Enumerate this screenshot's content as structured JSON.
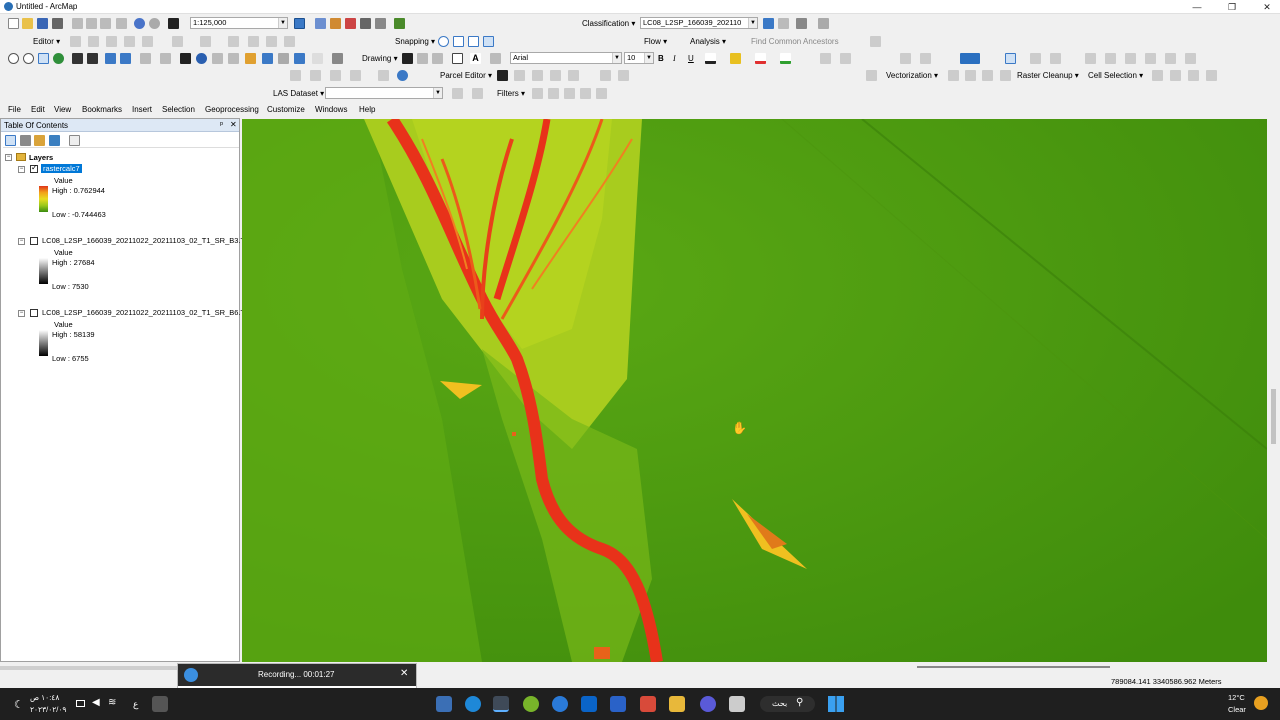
{
  "window": {
    "title": "Untitled - ArcMap",
    "minimize": "—",
    "maximize": "❐",
    "close": "✕"
  },
  "toolbar1": {
    "scale": "1:125,000",
    "classification_label": "Classification ▾",
    "layer_combo": "LC08_L2SP_166039_202110"
  },
  "toolbar2": {
    "editor": "Editor ▾",
    "snapping": "Snapping ▾",
    "drawing": "Drawing ▾",
    "font": "Arial",
    "font_size": "10",
    "bold": "B",
    "italic": "I",
    "underline": "U",
    "flow": "Flow ▾",
    "analysis": "Analysis ▾",
    "find_common_ancestors": "Find Common Ancestors"
  },
  "toolbar3": {
    "parcel_editor": "Parcel Editor ▾",
    "vectorization": "Vectorization ▾",
    "raster_cleanup": "Raster Cleanup ▾",
    "cell_selection": "Cell Selection ▾"
  },
  "toolbar4": {
    "las_dataset": "LAS Dataset ▾",
    "filters": "Filters ▾"
  },
  "menu": [
    "File",
    "Edit",
    "View",
    "Bookmarks",
    "Insert",
    "Selection",
    "Geoprocessing",
    "Customize",
    "Windows",
    "Help"
  ],
  "toc": {
    "title": "Table Of Contents",
    "pin": "ᵖ",
    "close": "✕",
    "root": "Layers",
    "layers": [
      {
        "name": "rastercalc7",
        "checked": true,
        "value_label": "Value",
        "high": "High : 0.762944",
        "low": "Low : -0.744463"
      },
      {
        "name": "LC08_L2SP_166039_20211022_20211103_02_T1_SR_B3.TIF",
        "checked": false,
        "value_label": "Value",
        "high": "High : 27684",
        "low": "Low : 7530"
      },
      {
        "name": "LC08_L2SP_166039_20211022_20211103_02_T1_SR_B6.TIF",
        "checked": false,
        "value_label": "Value",
        "high": "High : 58139",
        "low": "Low : 6755"
      }
    ]
  },
  "status": {
    "coordinates": "789084.141  3340586.962 Meters"
  },
  "recorder": {
    "status": "Recording... 00:01:27",
    "close": "✕"
  },
  "taskbar": {
    "time": "١٠:٤٨ ص",
    "date": "٢٠٢٣/٠٢/٠٩",
    "lang": "ع",
    "search": "بحث",
    "weather_temp": "12°C",
    "weather_desc": "Clear"
  },
  "colors": {
    "map_green": "#4f9c10",
    "river_red": "#e8321a",
    "delta_yellow": "#b8d21e",
    "selection_blue": "#0078d7"
  }
}
